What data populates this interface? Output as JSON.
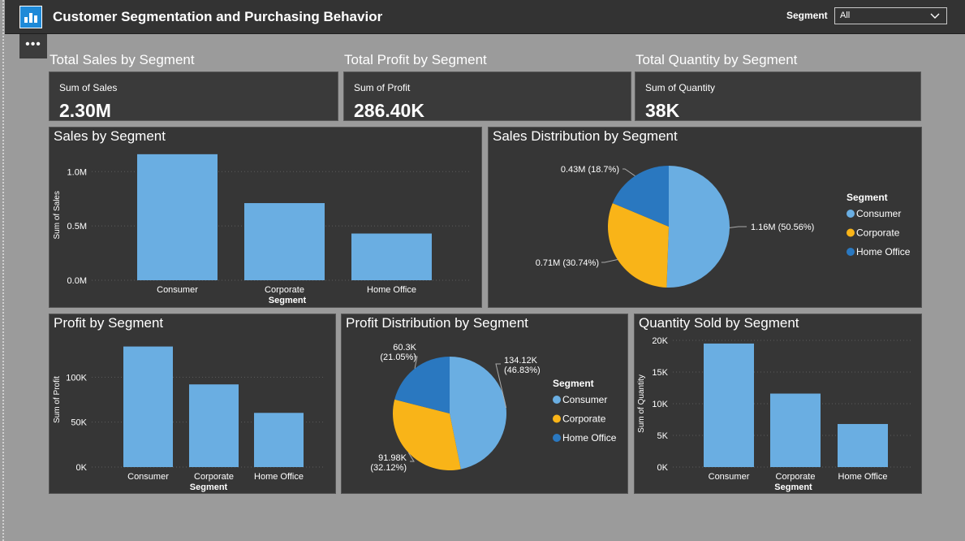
{
  "header": {
    "title": "Customer Segmentation and Purchasing Behavior",
    "icon": "bar-chart-icon",
    "filter_label": "Segment",
    "filter_value": "All",
    "more_label": "•••"
  },
  "colors": {
    "bar": "#6aaee2",
    "consumer": "#6aaee2",
    "corporate": "#f9b418",
    "home_office": "#2a78c0",
    "panel": "#363636",
    "background": "#9b9b9b"
  },
  "kpis": [
    {
      "title": "Total Sales by Segment",
      "label": "Sum of Sales",
      "value": "2.30M"
    },
    {
      "title": "Total Profit by Segment",
      "label": "Sum of Profit",
      "value": "286.40K"
    },
    {
      "title": "Total Quantity by Segment",
      "label": "Sum of Quantity",
      "value": "38K"
    }
  ],
  "chart_data": [
    {
      "id": "sales_bar",
      "type": "bar",
      "title": "Sales by Segment",
      "categories": [
        "Consumer",
        "Corporate",
        "Home Office"
      ],
      "values": [
        1.16,
        0.71,
        0.43
      ],
      "unit": "M",
      "ylim": [
        0,
        1.2
      ],
      "yticks": [
        0,
        0.5,
        1.0
      ],
      "yticklabels": [
        "0.0M",
        "0.5M",
        "1.0M"
      ],
      "xlabel": "Segment",
      "ylabel": "Sum of Sales",
      "grid": true
    },
    {
      "id": "sales_pie",
      "type": "pie",
      "title": "Sales Distribution by Segment",
      "legend_title": "Segment",
      "legend_position": "right",
      "slices": [
        {
          "label": "Consumer",
          "value": 50.56,
          "data_label": "1.16M (50.56%)"
        },
        {
          "label": "Corporate",
          "value": 30.74,
          "data_label": "0.71M (30.74%)"
        },
        {
          "label": "Home Office",
          "value": 18.7,
          "data_label": "0.43M (18.7%)"
        }
      ]
    },
    {
      "id": "profit_bar",
      "type": "bar",
      "title": "Profit by Segment",
      "categories": [
        "Consumer",
        "Corporate",
        "Home Office"
      ],
      "values": [
        134.12,
        91.98,
        60.3
      ],
      "unit": "K",
      "ylim": [
        0,
        150
      ],
      "yticks": [
        0,
        50,
        100
      ],
      "yticklabels": [
        "0K",
        "50K",
        "100K"
      ],
      "xlabel": "Segment",
      "ylabel": "Sum of Profit",
      "grid": true
    },
    {
      "id": "profit_pie",
      "type": "pie",
      "title": "Profit Distribution by Segment",
      "legend_title": "Segment",
      "legend_position": "right",
      "slices": [
        {
          "label": "Consumer",
          "value": 46.83,
          "data_label": [
            "134.12K",
            "(46.83%)"
          ]
        },
        {
          "label": "Corporate",
          "value": 32.12,
          "data_label": [
            "91.98K",
            "(32.12%)"
          ]
        },
        {
          "label": "Home Office",
          "value": 21.05,
          "data_label": [
            "60.3K",
            "(21.05%)"
          ]
        }
      ]
    },
    {
      "id": "qty_bar",
      "type": "bar",
      "title": "Quantity Sold by Segment",
      "categories": [
        "Consumer",
        "Corporate",
        "Home Office"
      ],
      "values": [
        19.5,
        11.6,
        6.8
      ],
      "unit": "K",
      "ylim": [
        0,
        20
      ],
      "yticks": [
        0,
        5,
        10,
        15,
        20
      ],
      "yticklabels": [
        "0K",
        "5K",
        "10K",
        "15K",
        "20K"
      ],
      "xlabel": "Segment",
      "ylabel": "Sum of Quantity",
      "grid": true
    }
  ]
}
